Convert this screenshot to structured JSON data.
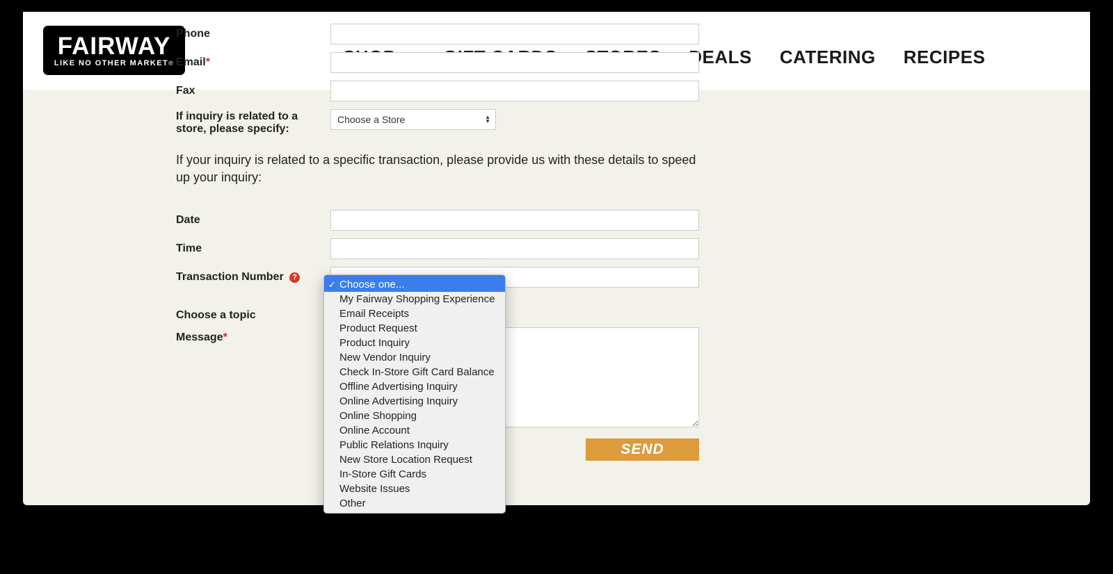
{
  "logo": {
    "main": "FAIRWAY",
    "sub": "LIKE NO OTHER MARKET",
    "reg": "®"
  },
  "nav": {
    "shop": "SHOP",
    "gift_cards": "GIFT CARDS",
    "stores": "STORES",
    "deals": "DEALS",
    "catering": "CATERING",
    "recipes": "RECIPES"
  },
  "form": {
    "phone": "Phone",
    "email": "Email",
    "fax": "Fax",
    "store_label": "If inquiry is related to a store, please specify:",
    "store_placeholder": "Choose a Store",
    "transaction_blurb": "If your inquiry is related to a specific transaction, please provide us with these details to speed up your inquiry:",
    "date": "Date",
    "time": "Time",
    "transaction_number": "Transaction Number",
    "choose_topic": "Choose a topic",
    "message": "Message",
    "send": "SEND"
  },
  "topic_dropdown": {
    "selected_index": 0,
    "options": [
      "Choose one...",
      "My Fairway Shopping Experience",
      "Email Receipts",
      "Product Request",
      "Product Inquiry",
      "New Vendor Inquiry",
      "Check In-Store Gift Card Balance",
      "Offline Advertising Inquiry",
      "Online Advertising Inquiry",
      "Online Shopping",
      "Online Account",
      "Public Relations Inquiry",
      "New Store Location Request",
      "In-Store Gift Cards",
      "Website Issues",
      "Other"
    ]
  }
}
